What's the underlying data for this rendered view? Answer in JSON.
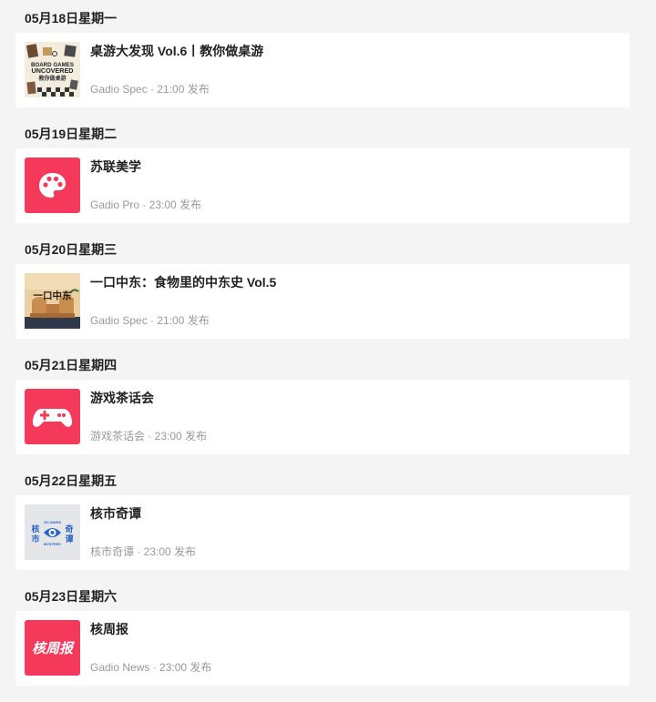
{
  "days": [
    {
      "date": "05月18日星期一",
      "title": "桌游大发现 Vol.6丨教你做桌游",
      "meta": "Gadio Spec · 21:00 发布",
      "thumb_icon": "board-games-cover-art",
      "thumb_text_1": "BOARD GAMES",
      "thumb_text_2": "UNCOVERED",
      "thumb_text_3": "教你做桌游"
    },
    {
      "date": "05月19日星期二",
      "title": "苏联美学",
      "meta": "Gadio Pro · 23:00 发布",
      "thumb_icon": "palette-icon",
      "thumb_color": "#f4395b"
    },
    {
      "date": "05月20日星期三",
      "title": "一口中东：食物里的中东史 Vol.5",
      "meta": "Gadio Spec · 21:00 发布",
      "thumb_icon": "middle-east-cover-art",
      "thumb_text_1": "一口中东"
    },
    {
      "date": "05月21日星期四",
      "title": "游戏茶话会",
      "meta": "游戏茶话会 · 23:00 发布",
      "thumb_icon": "gamepad-icon",
      "thumb_color": "#f4395b"
    },
    {
      "date": "05月22日星期五",
      "title": "核市奇谭",
      "meta": "核市奇谭 · 23:00 发布",
      "thumb_icon": "mystery-eye-logo",
      "thumb_text_1": "核",
      "thumb_text_2": "市",
      "thumb_text_3": "奇",
      "thumb_text_4": "谭",
      "thumb_text_5": "GC-MARS",
      "thumb_text_6": "MYSTERY"
    },
    {
      "date": "05月23日星期六",
      "title": "核周报",
      "meta": "Gadio News · 23:00 发布",
      "thumb_icon": "news-logo",
      "thumb_text_1": "核周报",
      "thumb_color": "#f4395b"
    }
  ]
}
